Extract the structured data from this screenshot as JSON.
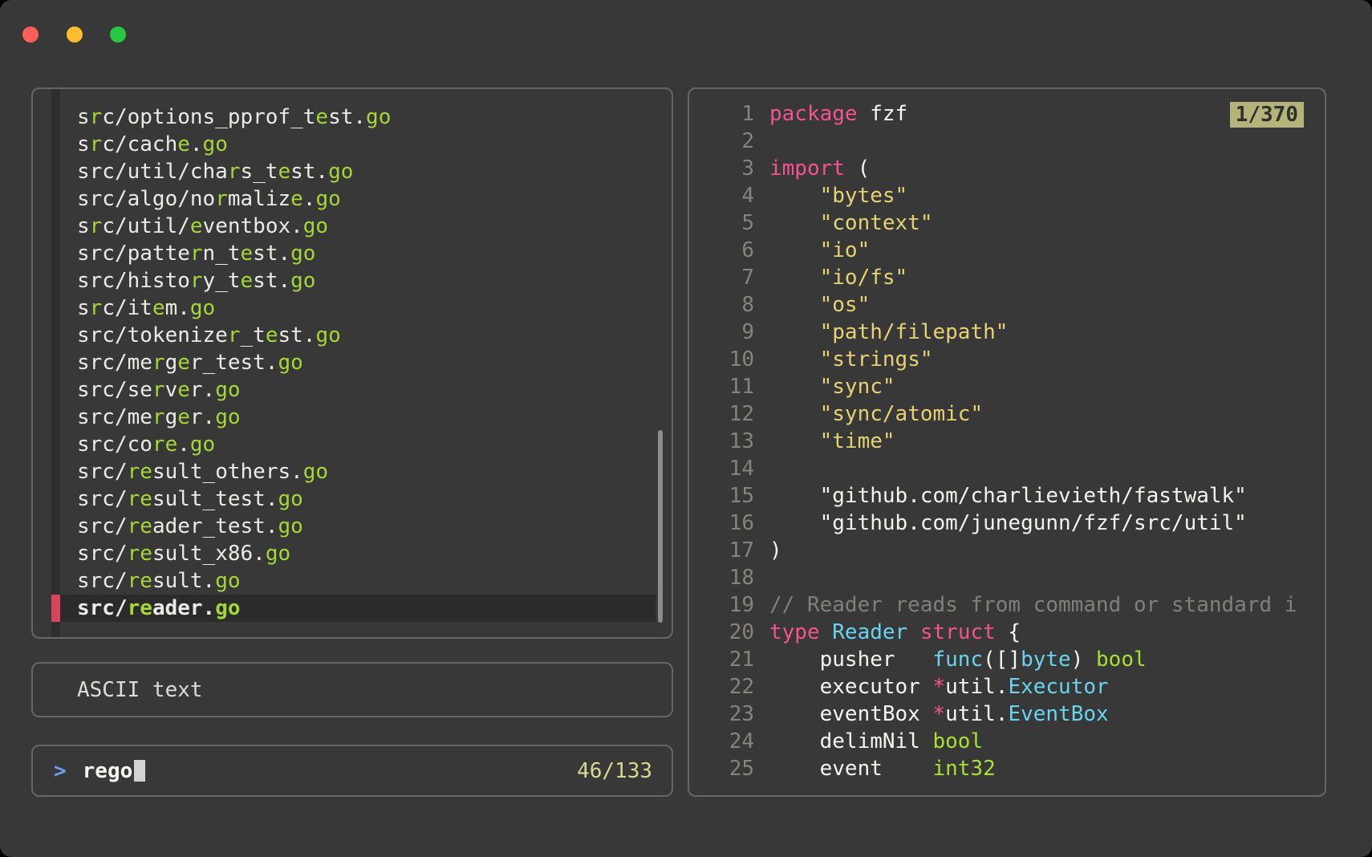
{
  "colors": {
    "bg": "#383838",
    "panel_border": "#666666",
    "fg": "#eaeae6",
    "match_green": "#a4d733",
    "selected_bg": "#2b2b2b",
    "pointer_red": "#d7455b",
    "gutter_bg": "#2e2e2e",
    "keyword_pink": "#f4548c",
    "string_yellow": "#e5d36f",
    "string_white": "#f3f3ee",
    "type_cyan": "#67d5ee",
    "green": "#a6e22e",
    "comment_gray": "#80807a",
    "linenum_gray": "#84847c",
    "badge_bg": "#b4b47a",
    "badge_fg": "#30302c",
    "count_yellow": "#d8d88f",
    "prompt_blue": "#6f9df2",
    "cursor": "#d2d2d2",
    "scrollbar": "#8c8c8c",
    "traffic_red": "#ff5f57",
    "traffic_yellow": "#febc2e",
    "traffic_green": "#28c840",
    "fg_code": "#f4f4f0"
  },
  "file_list": {
    "items": [
      {
        "segments": [
          {
            "t": "s"
          },
          {
            "t": "r",
            "m": true
          },
          {
            "t": "c/options_pprof_t"
          },
          {
            "t": "e",
            "m": true
          },
          {
            "t": "st."
          },
          {
            "t": "go",
            "m": true
          }
        ]
      },
      {
        "segments": [
          {
            "t": "s"
          },
          {
            "t": "r",
            "m": true
          },
          {
            "t": "c/cach"
          },
          {
            "t": "e",
            "m": true
          },
          {
            "t": "."
          },
          {
            "t": "go",
            "m": true
          }
        ]
      },
      {
        "segments": [
          {
            "t": "src/util/cha"
          },
          {
            "t": "r",
            "m": true
          },
          {
            "t": "s_t"
          },
          {
            "t": "e",
            "m": true
          },
          {
            "t": "st."
          },
          {
            "t": "go",
            "m": true
          }
        ]
      },
      {
        "segments": [
          {
            "t": "src/algo/no"
          },
          {
            "t": "r",
            "m": true
          },
          {
            "t": "maliz"
          },
          {
            "t": "e",
            "m": true
          },
          {
            "t": "."
          },
          {
            "t": "go",
            "m": true
          }
        ]
      },
      {
        "segments": [
          {
            "t": "s"
          },
          {
            "t": "r",
            "m": true
          },
          {
            "t": "c/util/"
          },
          {
            "t": "e",
            "m": true
          },
          {
            "t": "ventbox."
          },
          {
            "t": "go",
            "m": true
          }
        ]
      },
      {
        "segments": [
          {
            "t": "src/patte"
          },
          {
            "t": "r",
            "m": true
          },
          {
            "t": "n_t"
          },
          {
            "t": "e",
            "m": true
          },
          {
            "t": "st."
          },
          {
            "t": "go",
            "m": true
          }
        ]
      },
      {
        "segments": [
          {
            "t": "src/histo"
          },
          {
            "t": "r",
            "m": true
          },
          {
            "t": "y_t"
          },
          {
            "t": "e",
            "m": true
          },
          {
            "t": "st."
          },
          {
            "t": "go",
            "m": true
          }
        ]
      },
      {
        "segments": [
          {
            "t": "s"
          },
          {
            "t": "r",
            "m": true
          },
          {
            "t": "c/it"
          },
          {
            "t": "e",
            "m": true
          },
          {
            "t": "m."
          },
          {
            "t": "go",
            "m": true
          }
        ]
      },
      {
        "segments": [
          {
            "t": "src/tokenize"
          },
          {
            "t": "r",
            "m": true
          },
          {
            "t": "_t"
          },
          {
            "t": "e",
            "m": true
          },
          {
            "t": "st."
          },
          {
            "t": "go",
            "m": true
          }
        ]
      },
      {
        "segments": [
          {
            "t": "src/me"
          },
          {
            "t": "r",
            "m": true
          },
          {
            "t": "g"
          },
          {
            "t": "e",
            "m": true
          },
          {
            "t": "r_test."
          },
          {
            "t": "go",
            "m": true
          }
        ]
      },
      {
        "segments": [
          {
            "t": "src/se"
          },
          {
            "t": "r",
            "m": true
          },
          {
            "t": "v"
          },
          {
            "t": "e",
            "m": true
          },
          {
            "t": "r."
          },
          {
            "t": "go",
            "m": true
          }
        ]
      },
      {
        "segments": [
          {
            "t": "src/me"
          },
          {
            "t": "r",
            "m": true
          },
          {
            "t": "g"
          },
          {
            "t": "e",
            "m": true
          },
          {
            "t": "r."
          },
          {
            "t": "go",
            "m": true
          }
        ]
      },
      {
        "segments": [
          {
            "t": "src/co"
          },
          {
            "t": "re",
            "m": true
          },
          {
            "t": "."
          },
          {
            "t": "go",
            "m": true
          }
        ]
      },
      {
        "segments": [
          {
            "t": "src/"
          },
          {
            "t": "re",
            "m": true
          },
          {
            "t": "sult_others."
          },
          {
            "t": "go",
            "m": true
          }
        ]
      },
      {
        "segments": [
          {
            "t": "src/"
          },
          {
            "t": "re",
            "m": true
          },
          {
            "t": "sult_test."
          },
          {
            "t": "go",
            "m": true
          }
        ]
      },
      {
        "segments": [
          {
            "t": "src/"
          },
          {
            "t": "re",
            "m": true
          },
          {
            "t": "ader_test."
          },
          {
            "t": "go",
            "m": true
          }
        ]
      },
      {
        "segments": [
          {
            "t": "src/"
          },
          {
            "t": "re",
            "m": true
          },
          {
            "t": "sult_x86."
          },
          {
            "t": "go",
            "m": true
          }
        ]
      },
      {
        "segments": [
          {
            "t": "src/"
          },
          {
            "t": "re",
            "m": true
          },
          {
            "t": "sult."
          },
          {
            "t": "go",
            "m": true
          }
        ]
      },
      {
        "selected": true,
        "segments": [
          {
            "t": "src/"
          },
          {
            "t": "re",
            "m": true
          },
          {
            "t": "ader."
          },
          {
            "t": "go",
            "m": true
          }
        ]
      }
    ]
  },
  "info_box": {
    "label": "ASCII text"
  },
  "prompt": {
    "symbol": ">",
    "query": "rego",
    "counter": "46/133"
  },
  "preview": {
    "badge": "1/370",
    "lines": [
      {
        "n": "1",
        "tokens": [
          {
            "t": "package",
            "c": "k"
          },
          {
            "t": " fzf",
            "c": "w"
          }
        ]
      },
      {
        "n": "2",
        "tokens": []
      },
      {
        "n": "3",
        "tokens": [
          {
            "t": "import",
            "c": "k"
          },
          {
            "t": " (",
            "c": "w"
          }
        ]
      },
      {
        "n": "4",
        "tokens": [
          {
            "t": "    ",
            "c": "w"
          },
          {
            "t": "\"bytes\"",
            "c": "s"
          }
        ]
      },
      {
        "n": "5",
        "tokens": [
          {
            "t": "    ",
            "c": "w"
          },
          {
            "t": "\"context\"",
            "c": "s"
          }
        ]
      },
      {
        "n": "6",
        "tokens": [
          {
            "t": "    ",
            "c": "w"
          },
          {
            "t": "\"io\"",
            "c": "s"
          }
        ]
      },
      {
        "n": "7",
        "tokens": [
          {
            "t": "    ",
            "c": "w"
          },
          {
            "t": "\"io/fs\"",
            "c": "s"
          }
        ]
      },
      {
        "n": "8",
        "tokens": [
          {
            "t": "    ",
            "c": "w"
          },
          {
            "t": "\"os\"",
            "c": "s"
          }
        ]
      },
      {
        "n": "9",
        "tokens": [
          {
            "t": "    ",
            "c": "w"
          },
          {
            "t": "\"path/filepath\"",
            "c": "s"
          }
        ]
      },
      {
        "n": "10",
        "tokens": [
          {
            "t": "    ",
            "c": "w"
          },
          {
            "t": "\"strings\"",
            "c": "s"
          }
        ]
      },
      {
        "n": "11",
        "tokens": [
          {
            "t": "    ",
            "c": "w"
          },
          {
            "t": "\"sync\"",
            "c": "s"
          }
        ]
      },
      {
        "n": "12",
        "tokens": [
          {
            "t": "    ",
            "c": "w"
          },
          {
            "t": "\"sync/atomic\"",
            "c": "s"
          }
        ]
      },
      {
        "n": "13",
        "tokens": [
          {
            "t": "    ",
            "c": "w"
          },
          {
            "t": "\"time\"",
            "c": "s"
          }
        ]
      },
      {
        "n": "14",
        "tokens": []
      },
      {
        "n": "15",
        "tokens": [
          {
            "t": "    ",
            "c": "w"
          },
          {
            "t": "\"github.com/charlievieth/fastwalk\"",
            "c": "sw"
          }
        ]
      },
      {
        "n": "16",
        "tokens": [
          {
            "t": "    ",
            "c": "w"
          },
          {
            "t": "\"github.com/junegunn/fzf/src/util\"",
            "c": "sw"
          }
        ]
      },
      {
        "n": "17",
        "tokens": [
          {
            "t": ")",
            "c": "w"
          }
        ]
      },
      {
        "n": "18",
        "tokens": []
      },
      {
        "n": "19",
        "tokens": [
          {
            "t": "// Reader reads from command or standard i",
            "c": "c"
          }
        ]
      },
      {
        "n": "20",
        "tokens": [
          {
            "t": "type",
            "c": "k"
          },
          {
            "t": " ",
            "c": "w"
          },
          {
            "t": "Reader",
            "c": "t"
          },
          {
            "t": " ",
            "c": "w"
          },
          {
            "t": "struct",
            "c": "k"
          },
          {
            "t": " {",
            "c": "w"
          }
        ]
      },
      {
        "n": "21",
        "tokens": [
          {
            "t": "    pusher   ",
            "c": "w"
          },
          {
            "t": "func",
            "c": "t"
          },
          {
            "t": "([]",
            "c": "w"
          },
          {
            "t": "byte",
            "c": "t"
          },
          {
            "t": ") ",
            "c": "w"
          },
          {
            "t": "bool",
            "c": "g"
          }
        ]
      },
      {
        "n": "22",
        "tokens": [
          {
            "t": "    executor ",
            "c": "w"
          },
          {
            "t": "*",
            "c": "k"
          },
          {
            "t": "util.",
            "c": "w"
          },
          {
            "t": "Executor",
            "c": "t"
          }
        ]
      },
      {
        "n": "23",
        "tokens": [
          {
            "t": "    eventBox ",
            "c": "w"
          },
          {
            "t": "*",
            "c": "k"
          },
          {
            "t": "util.",
            "c": "w"
          },
          {
            "t": "EventBox",
            "c": "t"
          }
        ]
      },
      {
        "n": "24",
        "tokens": [
          {
            "t": "    delimNil ",
            "c": "w"
          },
          {
            "t": "bool",
            "c": "g"
          }
        ]
      },
      {
        "n": "25",
        "tokens": [
          {
            "t": "    event    ",
            "c": "w"
          },
          {
            "t": "int32",
            "c": "g"
          }
        ]
      }
    ]
  }
}
